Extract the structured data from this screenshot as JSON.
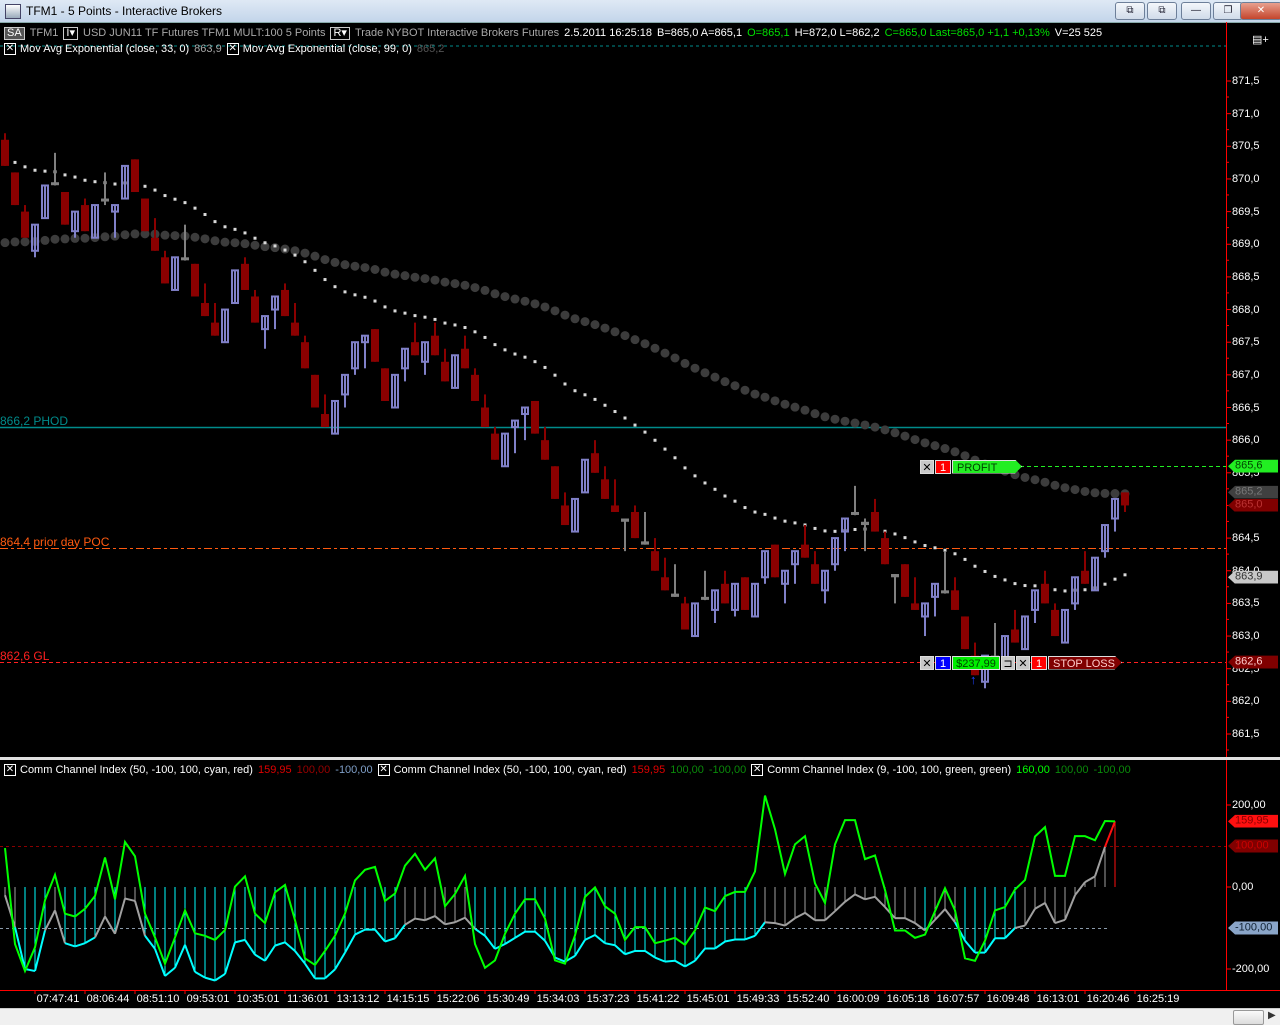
{
  "window": {
    "title": "TFM1 - 5 Points - Interactive Brokers",
    "buttons": [
      "⧉",
      "⧉",
      "—",
      "❐",
      "✕"
    ]
  },
  "header": {
    "account": "SA",
    "symbol": "TFM1",
    "interval_btn": "I▾",
    "description": "USD JUN11 TF Futures TFM1 MULT:100  5 Points",
    "r_btn": "R▾",
    "exchange": "Trade  NYBOT  Interactive Brokers  Futures",
    "datetime": "2.5.2011  16:25:18",
    "bid_ask": "B=865,0  A=865,1",
    "open": "O=865,1",
    "high_low": "H=872,0  L=862,2",
    "close_last": "C=865,0  Last=865,0  +1,1  +0,13%",
    "volume": "V=25 525",
    "panel_icon": "▤+"
  },
  "legends": {
    "ema1_label": "Mov Avg Exponential  (close,  33,  0)",
    "ema1_value": "863,9",
    "ema2_label": "Mov Avg Exponential  (close,  99,  0)",
    "ema2_value": "865,2",
    "cci1_label": "Comm Channel Index  (50,  -100,  100,  cyan,  red)",
    "cci1_v1": "159,95",
    "cci1_v2": "100,00",
    "cci1_v3": "-100,00",
    "cci2_label": "Comm Channel Index  (50,  -100,  100,  cyan,  red)",
    "cci2_v1": "159,95",
    "cci2_v2": "100,00",
    "cci2_v3": "-100,00",
    "cci3_label": "Comm Channel Index  (9,  -100,  100,  green,  green)",
    "cci3_v1": "160,00",
    "cci3_v2": "100,00",
    "cci3_v3": "-100,00",
    "close_glyph": "✕"
  },
  "price_axis": [
    "871,5",
    "871,0",
    "870,5",
    "870,0",
    "869,5",
    "869,0",
    "868,5",
    "868,0",
    "867,5",
    "867,0",
    "866,5",
    "866,0",
    "865,5",
    "865,0",
    "864,5",
    "864,0",
    "863,5",
    "863,0",
    "862,5",
    "862,0",
    "861,5"
  ],
  "cci_axis": [
    "200,00",
    "0,00",
    "-200,00"
  ],
  "levels": [
    {
      "label": "866,2 PHOD",
      "price": 866.2,
      "color": "#008b8b",
      "style": "solid"
    },
    {
      "label": "864,4 prior day POC",
      "price": 864.35,
      "color": "#ff5a10",
      "style": "dashdot"
    },
    {
      "label": "862,6 GL",
      "price": 862.6,
      "color": "#ff2020",
      "style": "dashed"
    }
  ],
  "price_markers": [
    {
      "text": "865,6",
      "price": 865.6,
      "bg": "#22ee22",
      "fg": "#004400"
    },
    {
      "text": "865,2",
      "price": 865.2,
      "bg": "#404040",
      "fg": "#777"
    },
    {
      "text": "865,0",
      "price": 865.0,
      "bg": "#800000",
      "fg": "#b33"
    },
    {
      "text": "863,9",
      "price": 863.9,
      "bg": "#c8c8c8",
      "fg": "#333"
    },
    {
      "text": "862,6",
      "price": 862.6,
      "bg": "#800000",
      "fg": "#fcc"
    }
  ],
  "cci_markers": [
    {
      "text": "159,95",
      "value": 159.95,
      "bg": "#ff1010",
      "fg": "#800"
    },
    {
      "text": "100,00",
      "value": 100,
      "bg": "#800000",
      "fg": "#c00"
    },
    {
      "text": "-100,00",
      "value": -100,
      "bg": "#8aa5c8",
      "fg": "#123"
    }
  ],
  "orders": {
    "profit": {
      "qty": "1",
      "label": "PROFIT TGT",
      "price": 865.6,
      "close": "✕"
    },
    "stop": {
      "qty_pos": "1",
      "pnl": "$237,99",
      "reverse": "⊐",
      "close": "✕",
      "qty": "1",
      "label": "STOP LOSS",
      "price": 862.6,
      "entry_arrow": "↑"
    }
  },
  "time_labels": [
    "07:47:41",
    "08:06:44",
    "08:51:10",
    "09:53:01",
    "10:35:01",
    "11:36:01",
    "13:13:12",
    "14:15:15",
    "15:22:06",
    "15:30:49",
    "15:34:03",
    "15:37:23",
    "15:41:22",
    "15:45:01",
    "15:49:33",
    "15:52:40",
    "16:00:09",
    "16:05:18",
    "16:07:57",
    "16:09:48",
    "16:13:01",
    "16:20:46",
    "16:25:19"
  ],
  "colors": {
    "up": "#8080c8",
    "down": "#8b0000",
    "doji": "#808080",
    "ema33": "#d8d8d8",
    "ema99": "#3c3c3c",
    "cci9": "#00ff00",
    "cci_low": "#00ffff",
    "cci_mid": "#a0a0a0",
    "cci_high": "#ff1010",
    "axis": "#ff0000"
  },
  "chart_data": {
    "type": "candlestick",
    "ema_periods": [
      33,
      99
    ],
    "ema_seed": [
      870.3,
      869.0
    ],
    "candles_ohlc": [
      [
        870.6,
        870.7,
        870.2,
        870.2
      ],
      [
        870.1,
        870.1,
        869.6,
        869.6
      ],
      [
        869.5,
        869.6,
        869.1,
        869.1
      ],
      [
        868.9,
        869.3,
        868.8,
        869.3
      ],
      [
        869.4,
        869.9,
        869.4,
        869.9
      ],
      [
        869.95,
        870.4,
        869.9,
        869.95
      ],
      [
        869.8,
        869.8,
        869.3,
        869.3
      ],
      [
        869.2,
        869.5,
        869.1,
        869.5
      ],
      [
        869.6,
        869.7,
        869.2,
        869.2
      ],
      [
        869.1,
        869.6,
        869.1,
        869.6
      ],
      [
        869.7,
        870.1,
        869.6,
        869.7
      ],
      [
        869.5,
        869.6,
        869.1,
        869.6
      ],
      [
        869.7,
        870.2,
        869.7,
        870.2
      ],
      [
        870.3,
        870.3,
        869.8,
        869.8
      ],
      [
        869.7,
        869.7,
        869.2,
        869.2
      ],
      [
        869.1,
        869.4,
        868.9,
        868.9
      ],
      [
        868.8,
        868.9,
        868.4,
        868.4
      ],
      [
        868.3,
        868.8,
        868.3,
        868.8
      ],
      [
        868.8,
        869.3,
        868.75,
        868.8
      ],
      [
        868.7,
        868.7,
        868.2,
        868.2
      ],
      [
        868.1,
        868.4,
        867.9,
        867.9
      ],
      [
        867.8,
        868.1,
        867.6,
        867.6
      ],
      [
        867.5,
        868.0,
        867.5,
        868.0
      ],
      [
        868.1,
        868.6,
        868.1,
        868.6
      ],
      [
        868.7,
        868.8,
        868.3,
        868.3
      ],
      [
        868.2,
        868.3,
        867.8,
        867.8
      ],
      [
        867.7,
        867.9,
        867.4,
        867.9
      ],
      [
        868.0,
        868.2,
        867.7,
        868.2
      ],
      [
        868.3,
        868.4,
        867.9,
        867.9
      ],
      [
        867.8,
        868.1,
        867.6,
        867.6
      ],
      [
        867.5,
        867.6,
        867.1,
        867.1
      ],
      [
        867.0,
        867.0,
        866.5,
        866.5
      ],
      [
        866.4,
        866.7,
        866.2,
        866.2
      ],
      [
        866.1,
        866.6,
        866.1,
        866.6
      ],
      [
        866.7,
        867.0,
        866.5,
        867.0
      ],
      [
        867.1,
        867.5,
        867.0,
        867.5
      ],
      [
        867.5,
        867.6,
        867.1,
        867.6
      ],
      [
        867.7,
        867.7,
        867.2,
        867.2
      ],
      [
        867.1,
        867.1,
        866.6,
        866.6
      ],
      [
        866.5,
        867.0,
        866.5,
        867.0
      ],
      [
        867.1,
        867.4,
        866.9,
        867.4
      ],
      [
        867.5,
        867.8,
        867.3,
        867.3
      ],
      [
        867.2,
        867.5,
        867.0,
        867.5
      ],
      [
        867.6,
        867.8,
        867.3,
        867.3
      ],
      [
        867.2,
        867.4,
        866.9,
        866.9
      ],
      [
        866.8,
        867.3,
        866.8,
        867.3
      ],
      [
        867.4,
        867.6,
        867.1,
        867.1
      ],
      [
        867.0,
        867.1,
        866.6,
        866.6
      ],
      [
        866.5,
        866.7,
        866.2,
        866.2
      ],
      [
        866.1,
        866.2,
        865.7,
        865.7
      ],
      [
        865.6,
        866.1,
        865.6,
        866.1
      ],
      [
        866.2,
        866.3,
        865.8,
        866.3
      ],
      [
        866.4,
        866.5,
        866.0,
        866.5
      ],
      [
        866.6,
        866.6,
        866.1,
        866.1
      ],
      [
        866.0,
        866.2,
        865.7,
        865.7
      ],
      [
        865.6,
        865.6,
        865.1,
        865.1
      ],
      [
        865.0,
        865.2,
        864.7,
        864.7
      ],
      [
        864.6,
        865.1,
        864.6,
        865.1
      ],
      [
        865.2,
        865.7,
        865.2,
        865.7
      ],
      [
        865.8,
        866.0,
        865.5,
        865.5
      ],
      [
        865.4,
        865.6,
        865.1,
        865.1
      ],
      [
        865.0,
        865.4,
        864.9,
        864.9
      ],
      [
        864.8,
        864.8,
        864.3,
        864.75
      ],
      [
        864.9,
        865.0,
        864.5,
        864.5
      ],
      [
        864.45,
        864.9,
        864.4,
        864.4
      ],
      [
        864.3,
        864.5,
        864.0,
        864.0
      ],
      [
        863.9,
        864.2,
        863.7,
        863.7
      ],
      [
        863.65,
        864.1,
        863.6,
        863.6
      ],
      [
        863.5,
        863.6,
        863.1,
        863.1
      ],
      [
        863.0,
        863.5,
        863.0,
        863.5
      ],
      [
        863.6,
        864.0,
        863.55,
        863.6
      ],
      [
        863.4,
        863.7,
        863.2,
        863.7
      ],
      [
        863.8,
        864.0,
        863.5,
        863.5
      ],
      [
        863.4,
        863.8,
        863.3,
        863.8
      ],
      [
        863.9,
        863.9,
        863.4,
        863.4
      ],
      [
        863.3,
        863.8,
        863.3,
        863.8
      ],
      [
        863.9,
        864.3,
        863.8,
        864.3
      ],
      [
        864.4,
        864.4,
        863.9,
        863.9
      ],
      [
        863.8,
        864.0,
        863.5,
        864.0
      ],
      [
        864.1,
        864.3,
        863.8,
        864.3
      ],
      [
        864.4,
        864.7,
        864.2,
        864.2
      ],
      [
        864.1,
        864.3,
        863.8,
        863.8
      ],
      [
        863.7,
        864.0,
        863.5,
        864.0
      ],
      [
        864.1,
        864.5,
        864.0,
        864.5
      ],
      [
        864.6,
        864.8,
        864.3,
        864.8
      ],
      [
        864.9,
        865.3,
        864.85,
        864.9
      ],
      [
        864.7,
        864.8,
        864.3,
        864.75
      ],
      [
        864.9,
        865.1,
        864.6,
        864.6
      ],
      [
        864.5,
        864.6,
        864.1,
        864.1
      ],
      [
        863.95,
        863.95,
        863.5,
        863.9
      ],
      [
        864.1,
        864.1,
        863.6,
        863.6
      ],
      [
        863.5,
        863.9,
        863.4,
        863.4
      ],
      [
        863.3,
        863.5,
        863.0,
        863.5
      ],
      [
        863.6,
        863.8,
        863.3,
        863.8
      ],
      [
        863.7,
        864.3,
        863.65,
        863.7
      ],
      [
        863.7,
        863.9,
        863.4,
        863.4
      ],
      [
        863.3,
        863.3,
        862.8,
        862.8
      ],
      [
        862.7,
        862.9,
        862.4,
        862.4
      ],
      [
        862.3,
        862.7,
        862.2,
        862.7
      ],
      [
        862.7,
        863.2,
        862.65,
        862.7
      ],
      [
        862.6,
        863.0,
        862.6,
        863.0
      ],
      [
        863.1,
        863.4,
        862.9,
        862.9
      ],
      [
        862.8,
        863.3,
        862.8,
        863.3
      ],
      [
        863.4,
        863.7,
        863.2,
        863.7
      ],
      [
        863.8,
        864.0,
        863.5,
        863.5
      ],
      [
        863.4,
        863.5,
        863.0,
        863.0
      ],
      [
        862.9,
        863.4,
        862.9,
        863.4
      ],
      [
        863.5,
        863.9,
        863.4,
        863.9
      ],
      [
        864.0,
        864.3,
        863.8,
        863.8
      ],
      [
        863.7,
        864.2,
        863.7,
        864.2
      ],
      [
        864.3,
        864.7,
        864.2,
        864.7
      ],
      [
        864.8,
        865.1,
        864.6,
        865.1
      ],
      [
        865.2,
        865.2,
        864.9,
        865.0
      ]
    ],
    "cci50": [
      -20,
      -98,
      -200,
      -205,
      -106,
      -57,
      -137,
      -145,
      -137,
      -123,
      -72,
      -114,
      -28,
      -34,
      -119,
      -151,
      -217,
      -197,
      -141,
      -207,
      -221,
      -228,
      -212,
      -135,
      -129,
      -165,
      -180,
      -143,
      -135,
      -156,
      -187,
      -223,
      -223,
      -201,
      -160,
      -116,
      -104,
      -104,
      -133,
      -125,
      -92,
      -77,
      -81,
      -71,
      -91,
      -86,
      -75,
      -102,
      -119,
      -151,
      -139,
      -124,
      -109,
      -109,
      -131,
      -172,
      -182,
      -168,
      -129,
      -117,
      -137,
      -142,
      -164,
      -156,
      -156,
      -172,
      -182,
      -180,
      -194,
      -180,
      -150,
      -150,
      -133,
      -128,
      -128,
      -119,
      -86,
      -88,
      -94,
      -76,
      -63,
      -81,
      -81,
      -59,
      -36,
      -18,
      -30,
      -24,
      -49,
      -76,
      -76,
      -88,
      -106,
      -80,
      -54,
      -86,
      -131,
      -160,
      -160,
      -125,
      -125,
      -100,
      -94,
      -53,
      -39,
      -88,
      -80,
      -20,
      12,
      26,
      98,
      159.95
    ],
    "cci9": [
      95,
      -139,
      -205,
      -147,
      -32,
      30,
      -65,
      -72,
      -53,
      -22,
      72,
      -30,
      110,
      75,
      -65,
      -123,
      -187,
      -123,
      -57,
      -113,
      -119,
      -129,
      -105,
      1,
      26,
      -65,
      -88,
      -13,
      5,
      -81,
      -174,
      -190,
      -156,
      -119,
      -65,
      16,
      42,
      49,
      -34,
      -16,
      52,
      81,
      42,
      70,
      -47,
      -17,
      27,
      -139,
      -197,
      -179,
      -114,
      -65,
      -30,
      -30,
      -77,
      -179,
      -187,
      -118,
      -24,
      -1,
      -47,
      -65,
      -129,
      -98,
      -98,
      -137,
      -131,
      -124,
      -141,
      -106,
      -50,
      -59,
      -22,
      -12,
      -12,
      38,
      223,
      141,
      32,
      104,
      124,
      9,
      -39,
      104,
      163,
      163,
      68,
      77,
      -7,
      -106,
      -106,
      -124,
      -116,
      -59,
      -3,
      -57,
      -174,
      -180,
      -131,
      -57,
      -49,
      -6,
      17,
      123,
      146,
      27,
      27,
      124,
      124,
      114,
      161,
      160
    ],
    "price_range": [
      861.2,
      871.8
    ],
    "cci_range": [
      -250,
      250
    ]
  }
}
